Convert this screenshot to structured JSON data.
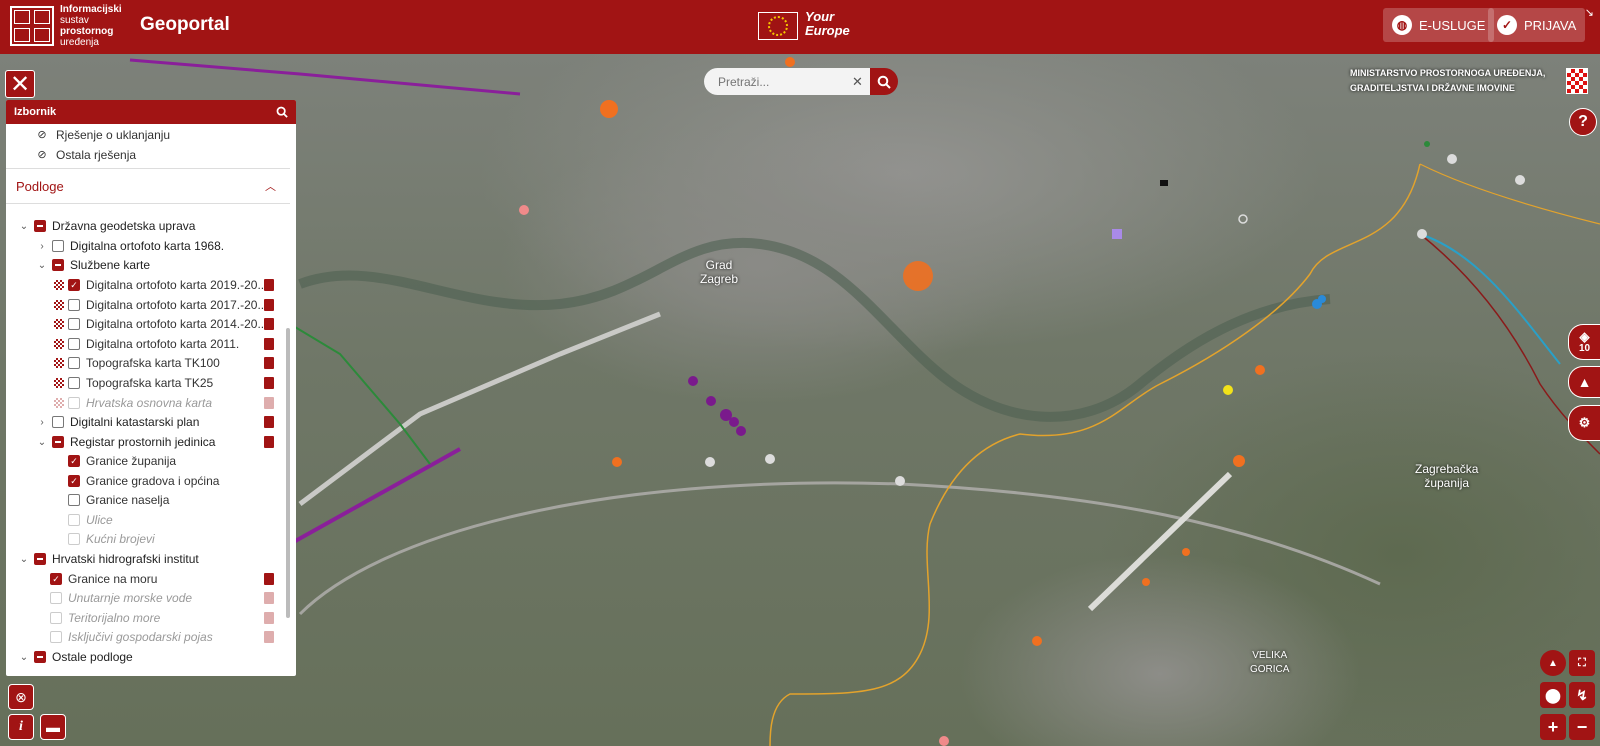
{
  "header": {
    "logo_lines": [
      "Informacijski",
      "sustav",
      "prostornog",
      "uređenja"
    ],
    "app_title": "Geoportal",
    "your_europe_line1": "Your",
    "your_europe_line2": "Europe",
    "eusluge_label": "E-USLUGE",
    "prijava_label": "PRIJAVA"
  },
  "search": {
    "placeholder": "Pretraži..."
  },
  "ministry": {
    "line1": "MINISTARSTVO PROSTORNOGA UREĐENJA,",
    "line2": "GRADITELJSTVA I DRŽAVNE IMOVINE"
  },
  "map": {
    "labels": {
      "grad": "Grad",
      "zagreb": "Zagreb",
      "zagrebacka": "Zagrebačka",
      "zupanija": "županija",
      "velika": "VELIKA",
      "gorica": "GORICA"
    },
    "layers_count": "10"
  },
  "panel": {
    "title": "Izbornik",
    "top_items": [
      "Rješenje o uklanjanju",
      "Ostala rješenja"
    ],
    "section_title": "Podloge",
    "tree": [
      {
        "label": "Državna geodetska uprava"
      },
      {
        "label": "Digitalna ortofoto karta 1968."
      },
      {
        "label": "Službene karte"
      },
      {
        "label": "Digitalna ortofoto karta 2019.-20..."
      },
      {
        "label": "Digitalna ortofoto karta 2017.-20..."
      },
      {
        "label": "Digitalna ortofoto karta 2014.-20..."
      },
      {
        "label": "Digitalna ortofoto karta 2011."
      },
      {
        "label": "Topografska karta TK100"
      },
      {
        "label": "Topografska karta TK25"
      },
      {
        "label": "Hrvatska osnovna karta"
      },
      {
        "label": "Digitalni katastarski plan"
      },
      {
        "label": "Registar prostornih jedinica"
      },
      {
        "label": "Granice županija"
      },
      {
        "label": "Granice gradova i općina"
      },
      {
        "label": "Granice naselja"
      },
      {
        "label": "Ulice"
      },
      {
        "label": "Kućni brojevi"
      },
      {
        "label": "Hrvatski hidrografski institut"
      },
      {
        "label": "Granice na moru"
      },
      {
        "label": "Unutarnje morske vode"
      },
      {
        "label": "Teritorijalno more"
      },
      {
        "label": "Isključivi gospodarski pojas"
      },
      {
        "label": "Ostale podloge"
      }
    ]
  },
  "colors": {
    "brand": "#a11414"
  }
}
